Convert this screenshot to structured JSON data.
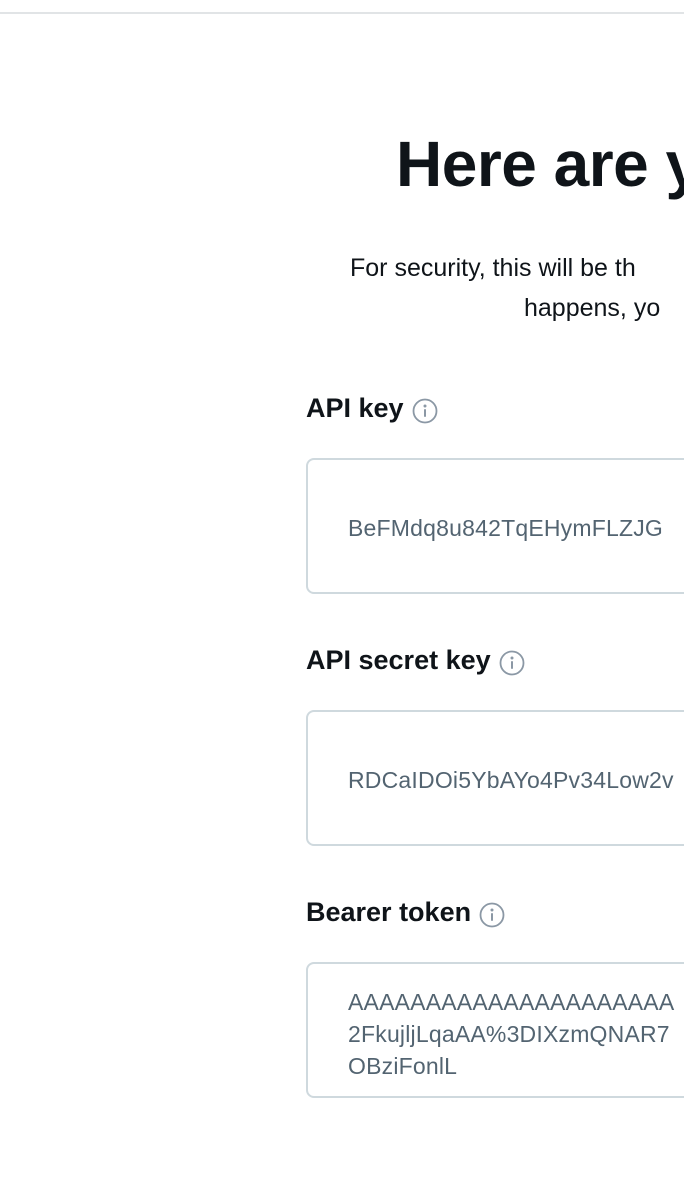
{
  "header": {
    "title": "Here are y"
  },
  "intro": {
    "line1": "For security, this will be th",
    "line2": "happens, yo"
  },
  "keys": {
    "api_key": {
      "label": "API key",
      "value": "BeFMdq8u842TqEHymFLZJG"
    },
    "api_secret_key": {
      "label": "API secret key",
      "value": "RDCaIDOi5YbAYo4Pv34Low2v"
    },
    "bearer_token": {
      "label": "Bearer token",
      "value_lines": [
        "AAAAAAAAAAAAAAAAAAAAA",
        "2FkujljLqaAA%3DIXzmQNAR7",
        "OBziFonlL"
      ]
    }
  },
  "icons": {
    "info": "info-circle-icon"
  },
  "colors": {
    "text_primary": "#0f1419",
    "text_secondary": "#536471",
    "border": "#cfd9de",
    "icon": "#8b98a5"
  }
}
